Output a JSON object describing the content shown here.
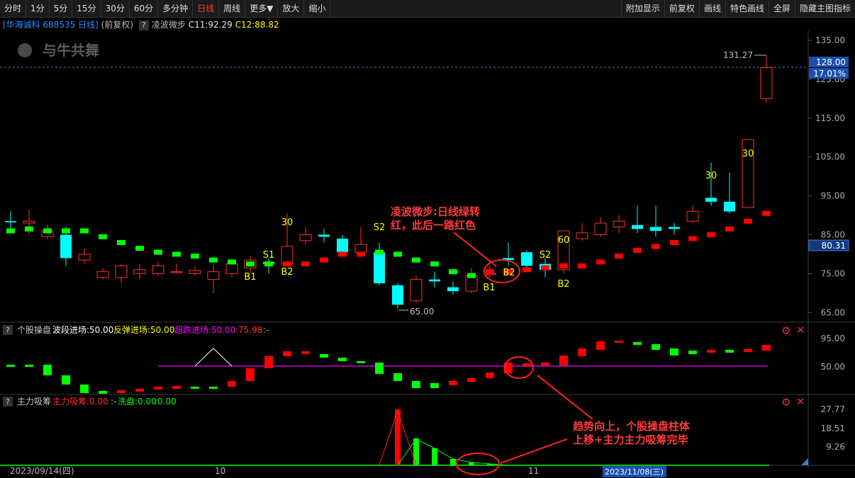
{
  "toolbar": {
    "left": [
      "分时",
      "1分",
      "5分",
      "15分",
      "30分",
      "60分",
      "多分钟",
      "日线",
      "周线",
      "更多▼",
      "放大",
      "缩小"
    ],
    "active": "日线",
    "right": [
      "附加显示",
      "前复权",
      "画线",
      "特色画线",
      "全屏",
      "隐藏主图指标"
    ]
  },
  "main_info": {
    "stock": "[华海诚科 688535 日线]",
    "adj": "(前复权)",
    "indicator": "凌波微步",
    "c11": "C11:92.29",
    "c12": "C12:88.82",
    "watermark": "与牛共舞"
  },
  "main_axis": {
    "ticks": [
      "135.00",
      "125.00",
      "115.00",
      "105.00",
      "95.00",
      "85.00",
      "75.00",
      "65.00"
    ],
    "last_price": "128.00",
    "last_pct": "17.01%",
    "cursor_price": "80.31",
    "high_label": "131.27",
    "low_label": "65.00"
  },
  "signals": [
    "30",
    "S1",
    "B1",
    "B2",
    "S2",
    "B1",
    "B2",
    "S2",
    "60",
    "B2",
    "30",
    "30"
  ],
  "annotations": {
    "main": [
      "凌波微步:日线绿转",
      "红，此后一路红色"
    ],
    "bottom": [
      "趋势向上，个股操盘柱体",
      "上移+主力主力吸筹完毕"
    ]
  },
  "pane2": {
    "name": "个股操盘",
    "items": [
      "波段进场:50.00",
      "反弹进场:50.00",
      "超跌进场:50.00",
      ":75.98",
      ":-"
    ],
    "ticks": [
      "95.00",
      "50.00"
    ]
  },
  "pane3": {
    "name": "主力吸筹",
    "items": [
      "主力吸筹:0.00",
      ":-",
      "洗盘:0.00",
      ":0.00"
    ],
    "ticks": [
      "27.77",
      "18.51",
      "9.26"
    ]
  },
  "xaxis": {
    "date_left": "2023/09/14(四)",
    "month_10": "10",
    "month_11": "11",
    "date_right": "2023/11/08(三)"
  },
  "colors": {
    "up": "#ff3232",
    "down": "#00ffff",
    "buy": "#ff0000",
    "sell": "#00ff00",
    "signal": "#ffff00"
  }
}
